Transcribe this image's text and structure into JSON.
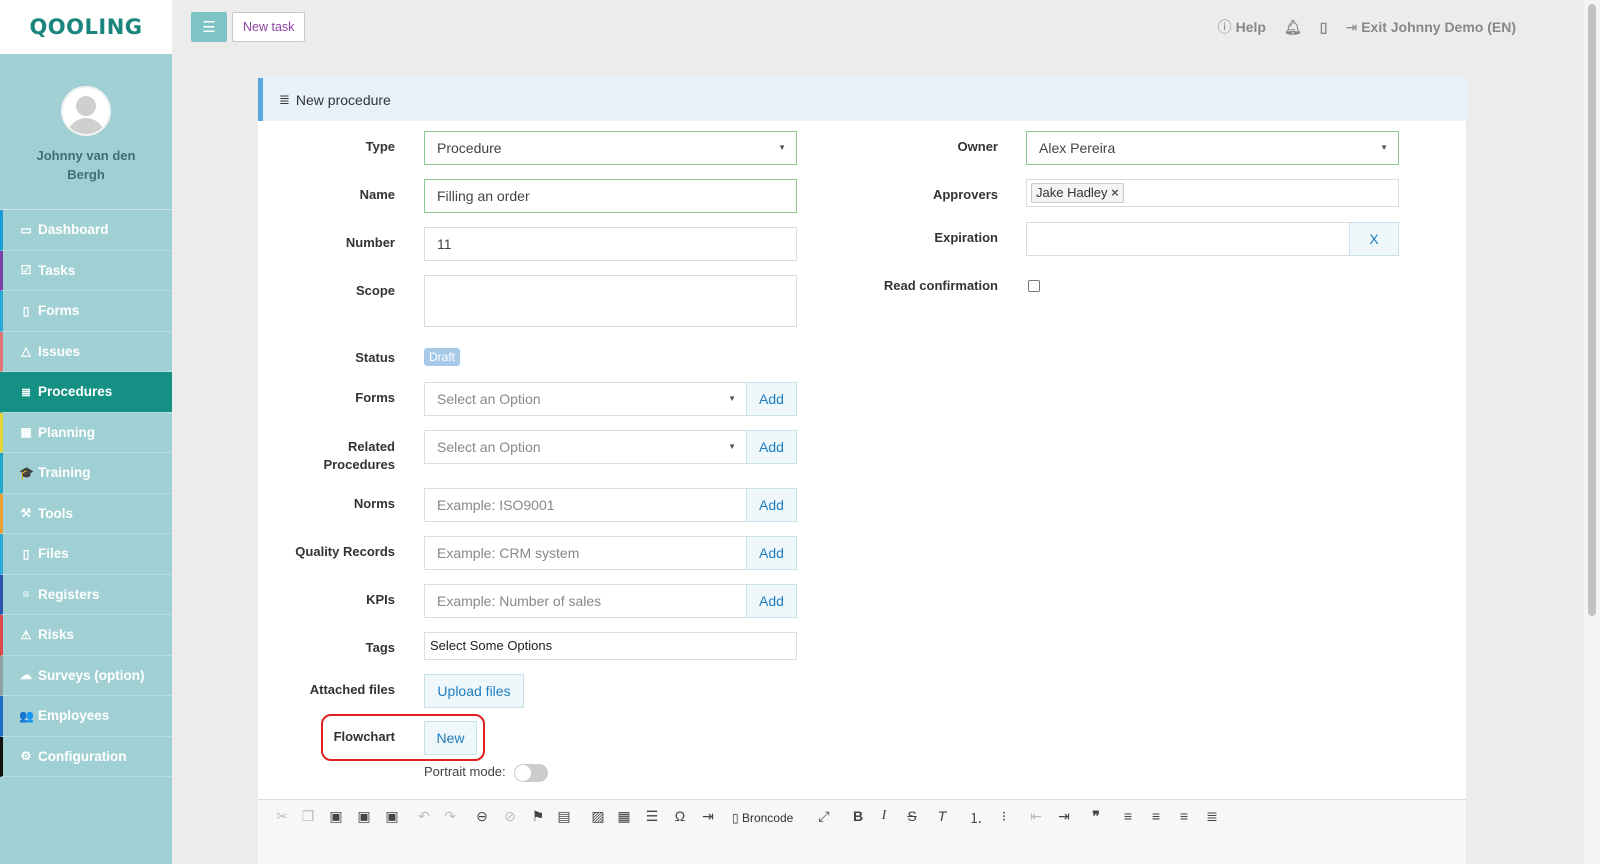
{
  "app": {
    "logo": "QOOLING"
  },
  "user": {
    "name": "Johnny van den Bergh"
  },
  "sidebar": {
    "items": [
      {
        "label": "Dashboard",
        "icon": "monitor-icon",
        "glyph": "▭",
        "color": "#1a9bd7"
      },
      {
        "label": "Tasks",
        "icon": "check-square-icon",
        "glyph": "☑",
        "color": "#7b3fa8"
      },
      {
        "label": "Forms",
        "icon": "file-icon",
        "glyph": "▯",
        "color": "#2aa8d8"
      },
      {
        "label": "Issues",
        "icon": "bell-icon",
        "glyph": "△",
        "color": "#e47373"
      },
      {
        "label": "Procedures",
        "icon": "list-icon",
        "glyph": "≣",
        "color": "#159084"
      },
      {
        "label": "Planning",
        "icon": "calendar-icon",
        "glyph": "▦",
        "color": "#e6d23a"
      },
      {
        "label": "Training",
        "icon": "graduation-cap-icon",
        "glyph": "🎓",
        "color": "#21a6c9"
      },
      {
        "label": "Tools",
        "icon": "wrench-icon",
        "glyph": "⚒",
        "color": "#f0a030"
      },
      {
        "label": "Files",
        "icon": "file-icon",
        "glyph": "▯",
        "color": "#2aa8d8"
      },
      {
        "label": "Registers",
        "icon": "list-icon",
        "glyph": "≡",
        "color": "#2d55b0"
      },
      {
        "label": "Risks",
        "icon": "warning-icon",
        "glyph": "⚠",
        "color": "#e04848"
      },
      {
        "label": "Surveys (option)",
        "icon": "comment-icon",
        "glyph": "☁",
        "color": "#8aa0a5"
      },
      {
        "label": "Employees",
        "icon": "users-icon",
        "glyph": "👥",
        "color": "#1e6ec8"
      },
      {
        "label": "Configuration",
        "icon": "gear-icon",
        "glyph": "⚙",
        "color": "#111111"
      }
    ]
  },
  "topbar": {
    "new_task": "New task",
    "help": "Help",
    "exit": "Exit Johnny Demo (EN)"
  },
  "panel": {
    "title": "New procedure"
  },
  "form": {
    "type": {
      "label": "Type",
      "value": "Procedure"
    },
    "name": {
      "label": "Name",
      "value": "Filling an order"
    },
    "number": {
      "label": "Number",
      "value": "11"
    },
    "scope": {
      "label": "Scope",
      "value": ""
    },
    "status": {
      "label": "Status",
      "value": "Draft"
    },
    "forms": {
      "label": "Forms",
      "placeholder": "Select an Option",
      "add": "Add"
    },
    "related": {
      "label_line1": "Related",
      "label_line2": "Procedures",
      "placeholder": "Select an Option",
      "add": "Add"
    },
    "norms": {
      "label": "Norms",
      "placeholder": "Example: ISO9001",
      "add": "Add"
    },
    "quality": {
      "label": "Quality Records",
      "placeholder": "Example: CRM system",
      "add": "Add"
    },
    "kpis": {
      "label": "KPIs",
      "placeholder": "Example: Number of sales",
      "add": "Add"
    },
    "tags": {
      "label": "Tags",
      "placeholder": "Select Some Options"
    },
    "attached": {
      "label": "Attached files",
      "button": "Upload files"
    },
    "flowchart": {
      "label": "Flowchart",
      "button": "New"
    },
    "portrait": {
      "label": "Portrait mode:"
    },
    "owner": {
      "label": "Owner",
      "value": "Alex Pereira"
    },
    "approvers": {
      "label": "Approvers",
      "token": "Jake Hadley"
    },
    "expiration": {
      "label": "Expiration",
      "clear": "X"
    },
    "read_confirmation": {
      "label": "Read confirmation"
    }
  },
  "editor": {
    "source_button": "Broncode"
  }
}
